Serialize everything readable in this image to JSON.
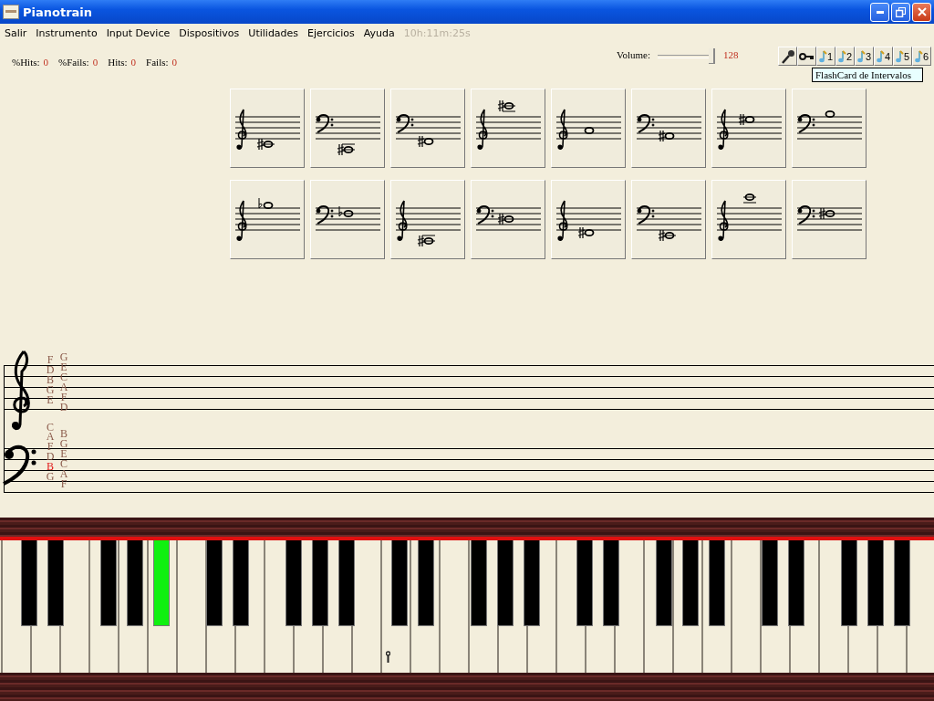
{
  "window": {
    "title": "Pianotrain"
  },
  "menu": {
    "items": [
      "Salir",
      "Instrumento",
      "Input Device",
      "Dispositivos",
      "Utilidades",
      "Ejercicios",
      "Ayuda"
    ],
    "timer": "10h:11m:25s"
  },
  "stats": [
    {
      "label": "%Hits:",
      "value": "0"
    },
    {
      "label": "%Fails:",
      "value": "0"
    },
    {
      "label": "Hits:",
      "value": "0"
    },
    {
      "label": "Fails:",
      "value": "0"
    }
  ],
  "volume": {
    "label": "Volume:",
    "level": 1.0,
    "reading": "128"
  },
  "toolbar": [
    {
      "kind": "mic"
    },
    {
      "kind": "key"
    },
    {
      "kind": "note",
      "label": "1"
    },
    {
      "kind": "note",
      "label": "2"
    },
    {
      "kind": "note",
      "label": "3"
    },
    {
      "kind": "note",
      "label": "4"
    },
    {
      "kind": "note",
      "label": "5"
    },
    {
      "kind": "note",
      "label": "6"
    }
  ],
  "tooltip": "FlashCard de Intervalos",
  "cards": [
    {
      "kind": "treble",
      "sharp": true,
      "flat": false
    },
    {
      "kind": "bass",
      "sharp": true,
      "flat": false
    },
    {
      "kind": "bass",
      "sharp": true,
      "flat": false
    },
    {
      "kind": "treble",
      "sharp": true,
      "flat": false
    },
    {
      "kind": "treble",
      "sharp": false,
      "flat": false
    },
    {
      "kind": "bass",
      "sharp": true,
      "flat": false
    },
    {
      "kind": "treble",
      "sharp": true,
      "flat": false
    },
    {
      "kind": "bass",
      "sharp": false,
      "flat": false
    },
    {
      "kind": "treble",
      "sharp": false,
      "flat": true
    },
    {
      "kind": "bass",
      "sharp": false,
      "flat": true
    },
    {
      "kind": "treble",
      "sharp": true,
      "flat": false
    },
    {
      "kind": "bass",
      "sharp": true,
      "flat": false
    },
    {
      "kind": "treble",
      "sharp": true,
      "flat": false
    },
    {
      "kind": "bass",
      "sharp": true,
      "flat": false
    },
    {
      "kind": "treble",
      "sharp": false,
      "flat": false
    },
    {
      "kind": "bass",
      "sharp": true,
      "flat": false
    }
  ],
  "note_names": [
    {
      "treble": [
        {
          "text": "F",
          "highlighted": false
        },
        {
          "text": "D",
          "highlighted": false
        },
        {
          "text": "B",
          "highlighted": false
        },
        {
          "text": "G",
          "highlighted": false
        },
        {
          "text": "E",
          "highlighted": false
        }
      ],
      "middle": [
        {
          "text": "C",
          "highlighted": false
        }
      ],
      "bass": [
        {
          "text": "A",
          "highlighted": false
        },
        {
          "text": "F",
          "highlighted": false
        },
        {
          "text": "D",
          "highlighted": false
        },
        {
          "text": "B",
          "highlighted": true
        },
        {
          "text": "G",
          "highlighted": false
        }
      ]
    },
    {
      "treble": [
        {
          "text": "G",
          "highlighted": false
        },
        {
          "text": "E",
          "highlighted": false
        },
        {
          "text": "C",
          "highlighted": false
        },
        {
          "text": "A",
          "highlighted": false
        },
        {
          "text": "F",
          "highlighted": false
        },
        {
          "text": "D",
          "highlighted": false
        }
      ],
      "bass": [
        {
          "text": "B",
          "highlighted": false
        },
        {
          "text": "G",
          "highlighted": false
        },
        {
          "text": "E",
          "highlighted": false
        },
        {
          "text": "C",
          "highlighted": false
        },
        {
          "text": "A",
          "highlighted": false
        },
        {
          "text": "F",
          "highlighted": false
        }
      ]
    }
  ],
  "black_keys": [
    {
      "pressed": false
    },
    {
      "pressed": false
    },
    {
      "pressed": false
    },
    {
      "pressed": false
    },
    {
      "pressed": true
    },
    {
      "pressed": false
    },
    {
      "pressed": false
    },
    {
      "pressed": false
    },
    {
      "pressed": false
    },
    {
      "pressed": false
    },
    {
      "pressed": false
    },
    {
      "pressed": false
    },
    {
      "pressed": false
    },
    {
      "pressed": false
    },
    {
      "pressed": false
    },
    {
      "pressed": false
    },
    {
      "pressed": false
    },
    {
      "pressed": false
    },
    {
      "pressed": false
    },
    {
      "pressed": false
    },
    {
      "pressed": false
    },
    {
      "pressed": false
    },
    {
      "pressed": false
    },
    {
      "pressed": false
    },
    {
      "pressed": false
    }
  ]
}
